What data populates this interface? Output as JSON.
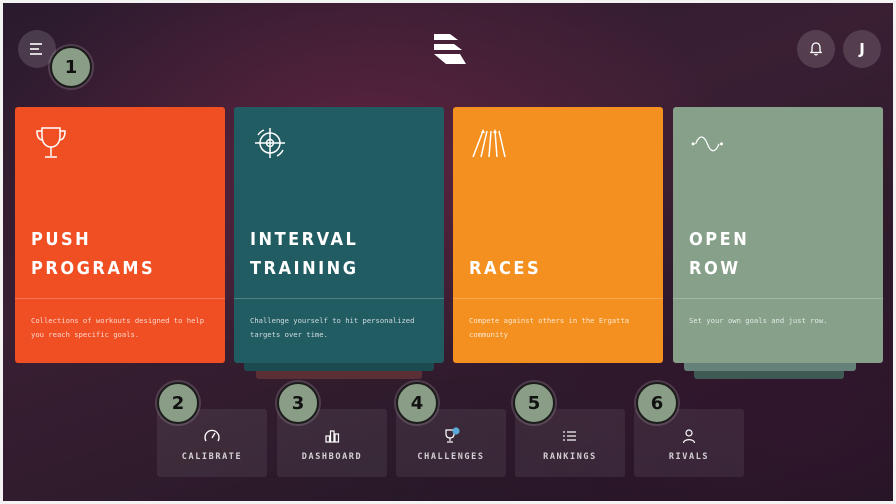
{
  "header": {
    "avatar_initial": "J"
  },
  "cards": [
    {
      "title": "PUSH\nPROGRAMS",
      "description": "Collections of workouts designed to help you reach specific goals.",
      "color": "#f04e23",
      "icon": "trophy-icon"
    },
    {
      "title": "INTERVAL\nTRAINING",
      "description": "Challenge yourself to hit personalized targets over time.",
      "color": "#225c63",
      "icon": "target-icon"
    },
    {
      "title": "RACES",
      "description": "Compete against others in the Ergatta community",
      "color": "#f39020",
      "icon": "race-lanes-icon"
    },
    {
      "title": "OPEN\nROW",
      "description": "Set your own goals and just row.",
      "color": "#86a08a",
      "icon": "wave-icon"
    }
  ],
  "nav": [
    {
      "label": "CALIBRATE",
      "icon": "gauge-icon"
    },
    {
      "label": "DASHBOARD",
      "icon": "bar-chart-icon"
    },
    {
      "label": "CHALLENGES",
      "icon": "trophy-globe-icon"
    },
    {
      "label": "RANKINGS",
      "icon": "list-icon"
    },
    {
      "label": "RIVALS",
      "icon": "person-icon"
    }
  ],
  "badges": [
    "1",
    "2",
    "3",
    "4",
    "5",
    "6"
  ],
  "colors": {
    "badge": "#8a9d86",
    "push": "#f04e23",
    "interval": "#225c63",
    "races": "#f39020",
    "open_row": "#86a08a"
  }
}
